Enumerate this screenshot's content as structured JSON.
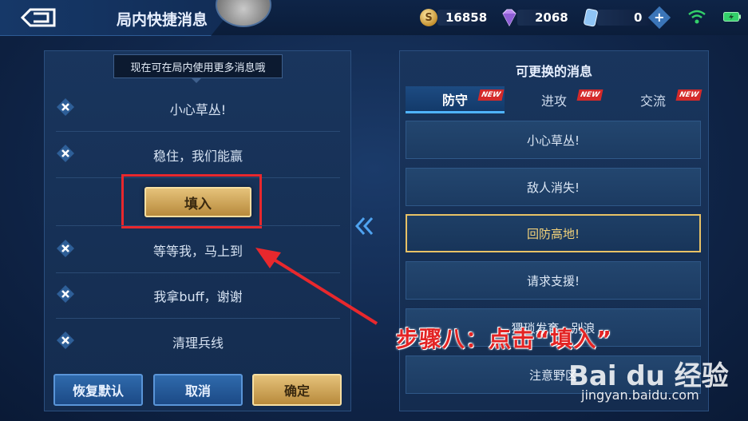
{
  "header": {
    "title": "局内快捷消息",
    "gold": "16858",
    "diamonds": "2068",
    "coupons": "0"
  },
  "left": {
    "tooltip": "现在可在局内使用更多消息哦",
    "messages": [
      "小心草丛!",
      "稳住，我们能赢",
      "等等我，马上到",
      "我拿buff，谢谢",
      "清理兵线"
    ],
    "fill_label": "填入",
    "restore_label": "恢复默认",
    "cancel_label": "取消",
    "confirm_label": "确定"
  },
  "right": {
    "title": "可更换的消息",
    "tabs": [
      {
        "label": "防守",
        "badge": "NEW"
      },
      {
        "label": "进攻",
        "badge": "NEW"
      },
      {
        "label": "交流",
        "badge": "NEW"
      }
    ],
    "options": [
      "小心草丛!",
      "敌人消失!",
      "回防高地!",
      "请求支援!",
      "猥琐发育，别浪",
      "注意野区"
    ]
  },
  "annotation": {
    "step_text": "步骤八：点击“填入”"
  },
  "watermark": {
    "logo": "Bai du 经验",
    "url": "jingyan.baidu.com"
  },
  "colors": {
    "highlight": "#e8282d",
    "gold_button": "#e5c27a",
    "selected_border": "#e8c266",
    "new_badge": "#d42a2a"
  }
}
